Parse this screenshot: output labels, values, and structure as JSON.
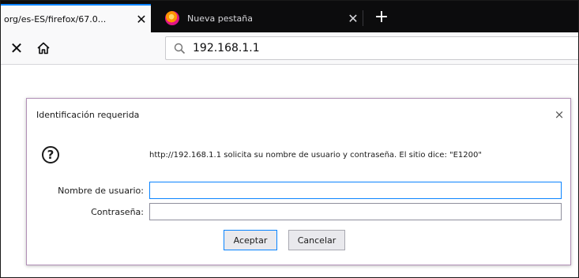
{
  "tabs": [
    {
      "title": "org/es-ES/firefox/67.0...",
      "active": true
    },
    {
      "title": "Nueva pestaña",
      "active": false
    }
  ],
  "new_tab_label": "+",
  "urlbar": {
    "value": "192.168.1.1"
  },
  "dialog": {
    "title": "Identificación requerida",
    "close": "×",
    "message": "http://192.168.1.1 solicita su nombre de usuario y contraseña. El sitio dice: \"E1200\"",
    "username_label": "Nombre de usuario:",
    "password_label": "Contraseña:",
    "username_value": "",
    "password_value": "",
    "ok_label": "Aceptar",
    "cancel_label": "Cancelar"
  },
  "colors": {
    "accent": "#0a84ff",
    "tabstrip": "#0c0c0d",
    "dialog_border": "#b18fb6"
  },
  "icons": [
    "close-icon",
    "firefox-icon",
    "stop-icon",
    "home-icon",
    "search-icon",
    "help-question-icon"
  ]
}
